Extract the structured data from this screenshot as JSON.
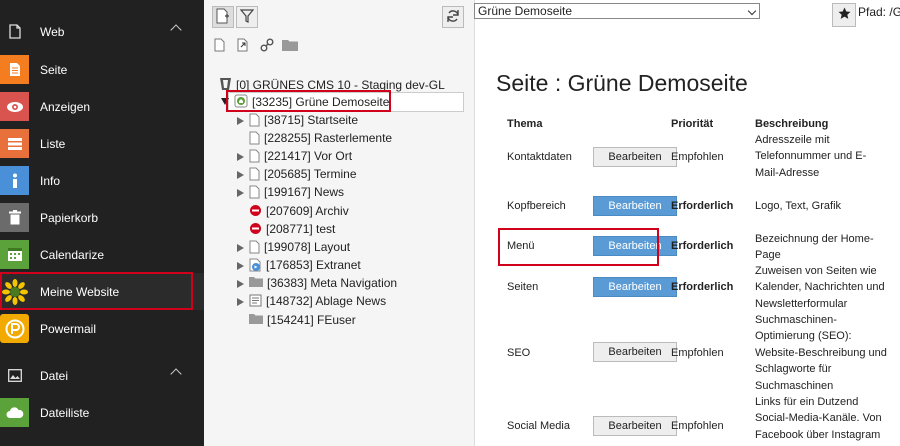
{
  "sidebar": {
    "sections": [
      {
        "label": "Web",
        "icon": "document-icon"
      },
      {
        "label": "Datei",
        "icon": "image-icon"
      }
    ],
    "items": [
      {
        "label": "Seite",
        "icon": "page-icon",
        "color": "#f47d20"
      },
      {
        "label": "Anzeigen",
        "icon": "eye-icon",
        "color": "#d9534f"
      },
      {
        "label": "Liste",
        "icon": "list-icon",
        "color": "#e8703a"
      },
      {
        "label": "Info",
        "icon": "info-icon",
        "color": "#4a90d9"
      },
      {
        "label": "Papierkorb",
        "icon": "trash-icon",
        "color": "#6b6b6b"
      },
      {
        "label": "Calendarize",
        "icon": "calendar-icon",
        "color": "#5ba23a"
      },
      {
        "label": "Meine Website",
        "icon": "sunflower-icon",
        "color": "#f5c400"
      },
      {
        "label": "Powermail",
        "icon": "powermail-icon",
        "color": "#f2a900"
      },
      {
        "label": "Dateiliste",
        "icon": "cloud-icon",
        "color": "#5ba23a"
      }
    ]
  },
  "tree": {
    "root": "[0] GRÜNES CMS 10 - Staging dev-GL",
    "selected": "[33235] Grüne Demoseite",
    "children": [
      "[38715] Startseite",
      "[228255] Rasterlemente",
      "[221417] Vor Ort",
      "[205685] Termine",
      "[199167] News",
      "[207609] Archiv",
      "[208771] test",
      "[199078] Layout",
      "[176853] Extranet",
      "[36383] Meta Navigation",
      "[148732] Ablage News",
      "[154241] FEuser"
    ]
  },
  "content": {
    "page_select": "Grüne Demoseite",
    "path": "Pfad: /Gr",
    "title": "Seite : Grüne Demoseite",
    "headers": {
      "thema": "Thema",
      "prioritaet": "Priorität",
      "beschreibung": "Beschreibung"
    },
    "rows": [
      {
        "thema": "Kontaktdaten",
        "button": "Bearbeiten",
        "priority": "Empfohlen",
        "desc": [
          "Adresszeile mit",
          "Telefonnummer und E-",
          "Mail-Adresse"
        ]
      },
      {
        "thema": "Kopfbereich",
        "button": "Bearbeiten",
        "priority": "Erforderlich",
        "desc": [
          "Logo, Text, Grafik"
        ]
      },
      {
        "thema": "Menü",
        "button": "Bearbeiten",
        "priority": "Erforderlich",
        "desc": [
          "Bezeichnung der Home-",
          "Page"
        ]
      },
      {
        "thema": "Seiten",
        "button": "Bearbeiten",
        "priority": "Erforderlich",
        "desc": [
          "Zuweisen von Seiten wie",
          "Kalender, Nachrichten und",
          "Newsletterformular"
        ]
      },
      {
        "thema": "SEO",
        "button": "Bearbeiten",
        "priority": "Empfohlen",
        "desc": [
          "Suchmaschinen-",
          "Optimierung (SEO):",
          "Website-Beschreibung und",
          "Schlagworte für",
          "Suchmaschinen"
        ]
      },
      {
        "thema": "Social Media",
        "button": "Bearbeiten",
        "priority": "Empfohlen",
        "desc": [
          "Links für ein Dutzend",
          "Social-Media-Kanäle. Von",
          "Facebook über Instagram"
        ]
      }
    ]
  }
}
